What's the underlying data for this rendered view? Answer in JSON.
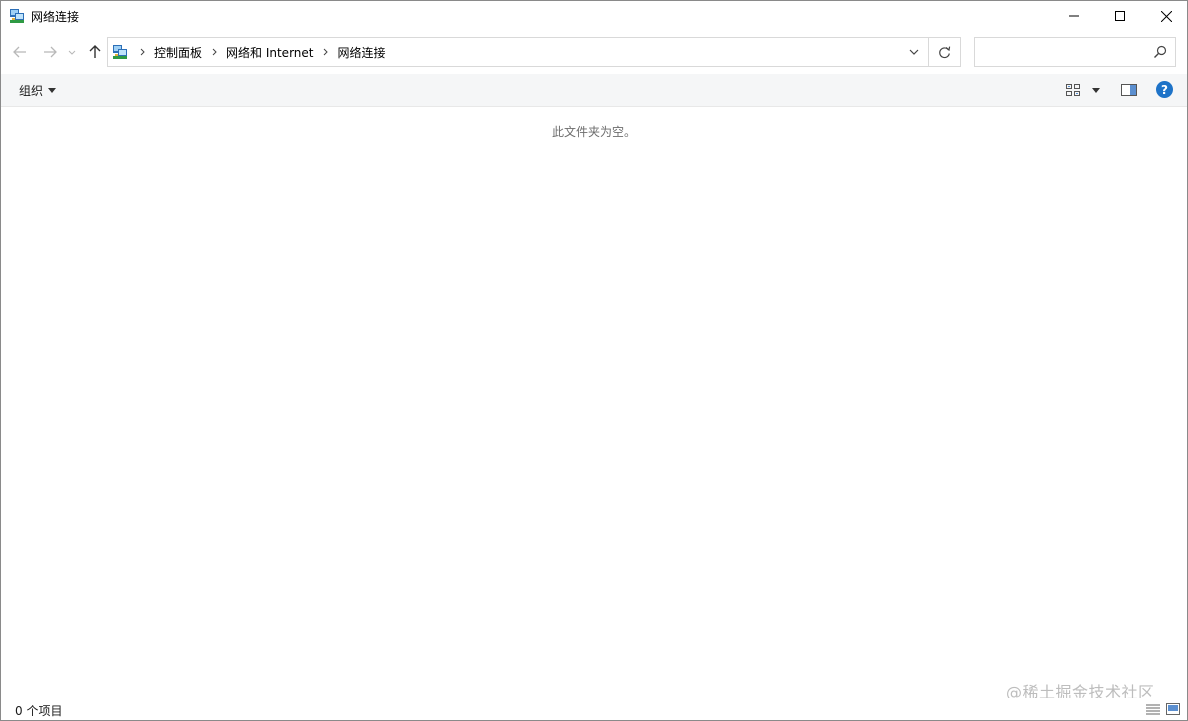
{
  "window": {
    "title": "网络连接"
  },
  "navigation": {
    "breadcrumbs": [
      "控制面板",
      "网络和 Internet",
      "网络连接"
    ],
    "search_placeholder": ""
  },
  "toolbar": {
    "organize_label": "组织"
  },
  "content": {
    "empty_message": "此文件夹为空。"
  },
  "status": {
    "item_count": "0 个项目"
  },
  "watermark": "@稀土掘金技术社区",
  "colors": {
    "help": "#1e73c8",
    "command_bar_bg": "#f5f6f7"
  },
  "icons": {
    "app": "network-connections-icon",
    "back": "arrow-left-icon",
    "forward": "arrow-right-icon",
    "up": "arrow-up-icon",
    "refresh": "refresh-icon",
    "search": "search-icon",
    "help": "help-icon"
  }
}
